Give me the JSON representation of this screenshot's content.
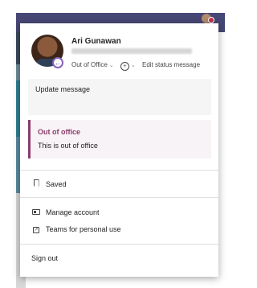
{
  "profile": {
    "name": "Ari Gunawan",
    "status": "Out of Office",
    "edit_status": "Edit status message"
  },
  "update_message": "Update message",
  "out_of_office": {
    "title": "Out of office",
    "message": "This is out of office"
  },
  "menu": {
    "saved": "Saved",
    "manage_account": "Manage account",
    "teams_personal": "Teams for personal use",
    "sign_out": "Sign out"
  },
  "icons": {
    "presence": "out-of-office-arrow-icon",
    "emoji": "emoji-add-icon",
    "saved": "bookmark-icon",
    "manage_account": "id-card-icon",
    "teams_personal": "open-external-icon"
  },
  "colors": {
    "teams_header": "#464775",
    "ooo_accent": "#8a3c6b",
    "presence_ooo": "#8764b8"
  }
}
